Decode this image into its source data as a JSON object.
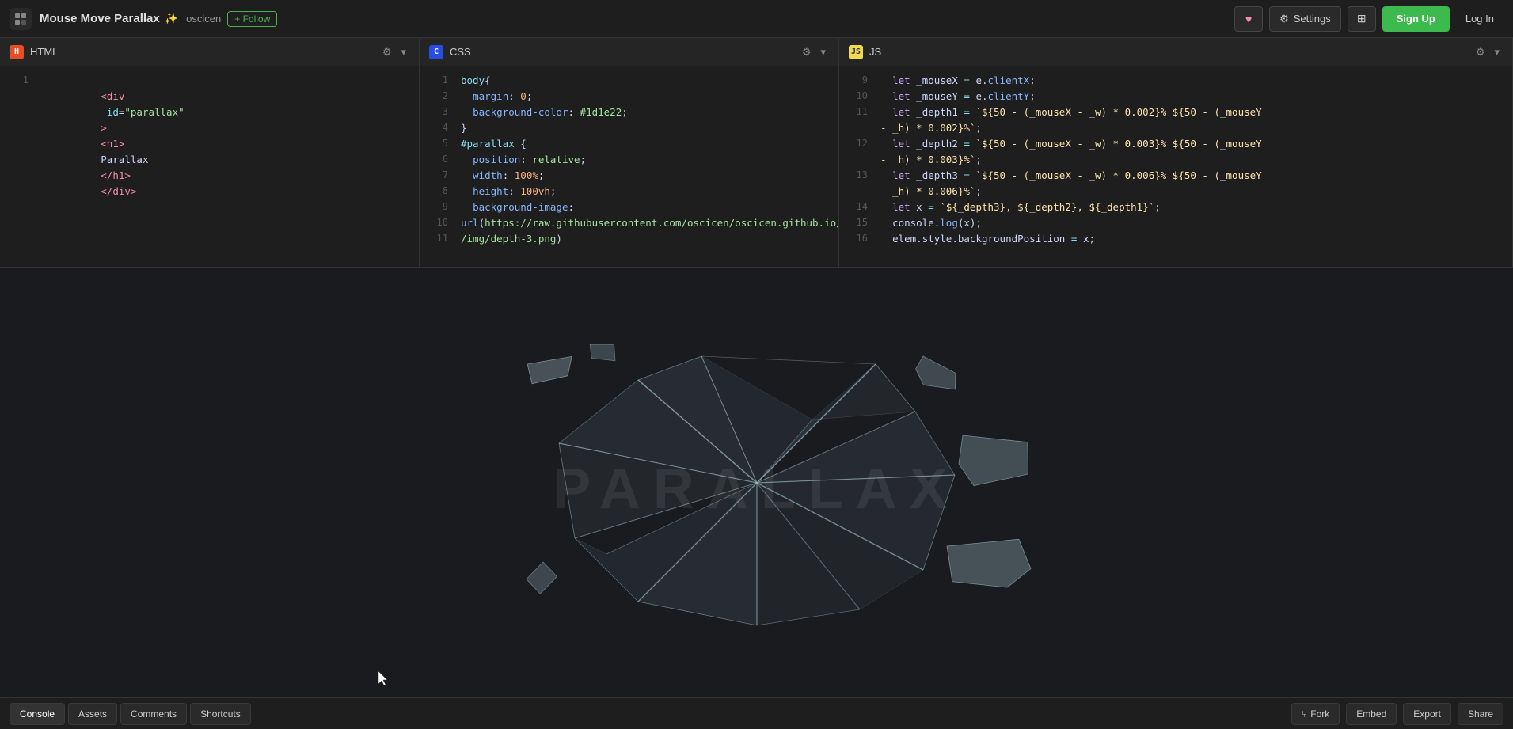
{
  "app": {
    "title": "Mouse Move Parallax",
    "sparkle": "✨",
    "username": "oscicen",
    "follow_label": "+ Follow"
  },
  "topbar": {
    "heart_icon": "♥",
    "settings_label": "Settings",
    "grid_icon": "⊞",
    "signup_label": "Sign Up",
    "login_label": "Log In"
  },
  "editors": {
    "html": {
      "label": "HTML",
      "lines": [
        {
          "num": "1",
          "code": "<div id=\"parallax\"><h1>Parallax</h1></div>"
        }
      ]
    },
    "css": {
      "label": "CSS",
      "lines": [
        {
          "num": "1",
          "code": "body{"
        },
        {
          "num": "2",
          "code": "  margin: 0;"
        },
        {
          "num": "3",
          "code": "  background-color: #1d1e22;"
        },
        {
          "num": "4",
          "code": "}"
        },
        {
          "num": "5",
          "code": "#parallax {"
        },
        {
          "num": "6",
          "code": "  position: relative;"
        },
        {
          "num": "7",
          "code": "  width: 100%;"
        },
        {
          "num": "8",
          "code": "  height: 100vh;"
        },
        {
          "num": "9",
          "code": "  background-image:"
        },
        {
          "num": "10",
          "code": "url(https://raw.githubusercontent.com/oscicen/oscicen.github.io/master"
        },
        {
          "num": "11",
          "code": "/img/depth-3.png)"
        }
      ]
    },
    "js": {
      "label": "JS",
      "lines": [
        {
          "num": "9",
          "code": "  let _mouseX = e.clientX;"
        },
        {
          "num": "10",
          "code": "  let _mouseY = e.clientY;"
        },
        {
          "num": "11",
          "code": "  let _depth1 = `${50 - (_mouseX - _w) * 0.002}% ${50 - (_mouseY"
        },
        {
          "num": "",
          "code": "- _h) * 0.002}%`;"
        },
        {
          "num": "12",
          "code": "  let _depth2 = `${50 - (_mouseX - _w) * 0.003}% ${50 - (_mouseY"
        },
        {
          "num": "",
          "code": "- _h) * 0.003}%`;"
        },
        {
          "num": "13",
          "code": "  let _depth3 = `${50 - (_mouseX - _w) * 0.006}% ${50 - (_mouseY"
        },
        {
          "num": "",
          "code": "- _h) * 0.006}%`;"
        },
        {
          "num": "14",
          "code": "  let x = `${_depth3}, ${_depth2}, ${_depth1}`;"
        },
        {
          "num": "15",
          "code": "  console.log(x);"
        },
        {
          "num": "16",
          "code": "  elem.style.backgroundPosition = x;"
        }
      ]
    }
  },
  "preview": {
    "text": "PARALLAX"
  },
  "bottom": {
    "console_label": "Console",
    "assets_label": "Assets",
    "comments_label": "Comments",
    "shortcuts_label": "Shortcuts",
    "fork_label": "Fork",
    "embed_label": "Embed",
    "export_label": "Export",
    "share_label": "Share"
  }
}
